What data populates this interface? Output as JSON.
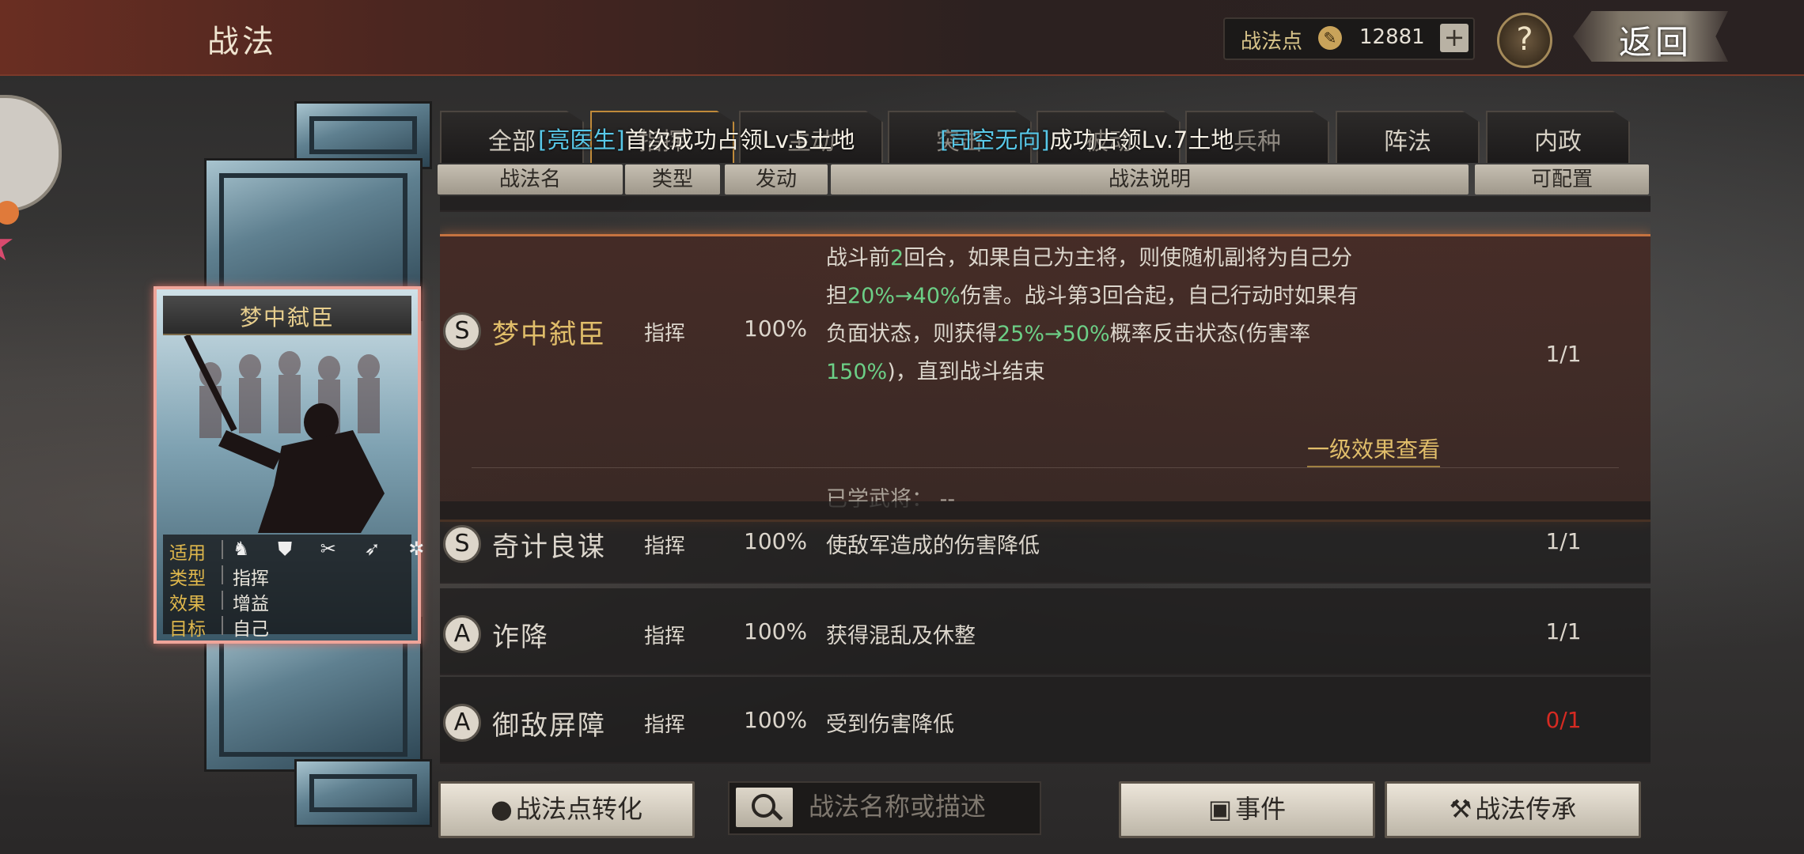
{
  "header": {
    "title": "战法",
    "points_label": "战法点",
    "points_value": "12881",
    "add_label": "+",
    "help_label": "?",
    "back_label": "返回"
  },
  "card": {
    "title": "梦中弑臣",
    "rows": [
      {
        "key": "适用",
        "value": "♞ ⛊ ✂ ➶ ✲"
      },
      {
        "key": "类型",
        "value": "指挥"
      },
      {
        "key": "效果",
        "value": "增益"
      },
      {
        "key": "目标",
        "value": "自己"
      }
    ]
  },
  "tabs": [
    {
      "label": "全部"
    },
    {
      "label": "指挥"
    },
    {
      "label": "主动"
    },
    {
      "label": "突击"
    },
    {
      "label": "被动"
    },
    {
      "label": "兵种"
    },
    {
      "label": "阵法"
    },
    {
      "label": "内政"
    }
  ],
  "ticker": [
    {
      "name": "[亮医生]",
      "text": "首次成功占领Lv.5土地"
    },
    {
      "name": "[司空无向]",
      "text": "成功占领Lv.7土地"
    }
  ],
  "columns": {
    "name": "战法名",
    "type": "类型",
    "trigger": "发动",
    "desc": "战法说明",
    "config": "可配置"
  },
  "skills": [
    {
      "grade": "S",
      "name": "梦中弑臣",
      "type": "指挥",
      "rate": "100%",
      "desc_lines": [
        [
          "战斗前",
          "2",
          "回合，如果自己为主将，则使随机副将为自己分"
        ],
        [
          "担",
          "20%→40%",
          "伤害。战斗第3回合起，自己行动时如果有"
        ],
        [
          "负面状态，则获得",
          "25%→50%",
          "概率反击状态(伤害率"
        ],
        [
          "",
          "150%",
          ")，直到战斗结束"
        ]
      ],
      "effect_link": "一级效果查看",
      "learned_label": "已学武将：",
      "learned_value": "--",
      "count": "1/1"
    },
    {
      "grade": "S",
      "name": "奇计良谋",
      "type": "指挥",
      "rate": "100%",
      "desc": "使敌军造成的伤害降低",
      "count": "1/1"
    },
    {
      "grade": "A",
      "name": "诈降",
      "type": "指挥",
      "rate": "100%",
      "desc": "获得混乱及休整",
      "count": "1/1"
    },
    {
      "grade": "A",
      "name": "御敌屏障",
      "type": "指挥",
      "rate": "100%",
      "desc": "受到伤害降低",
      "count": "0/1",
      "count_red": true
    }
  ],
  "bottom": {
    "convert_label": "战法点转化",
    "search_placeholder": "战法名称或描述",
    "events_label": "事件",
    "inherit_label": "战法传承"
  },
  "colors": {
    "accent_gold": "#e0bd6a",
    "highlight_green": "#6ccf86",
    "player_name_blue": "#58c8e8",
    "warning_red": "#d62a22"
  }
}
